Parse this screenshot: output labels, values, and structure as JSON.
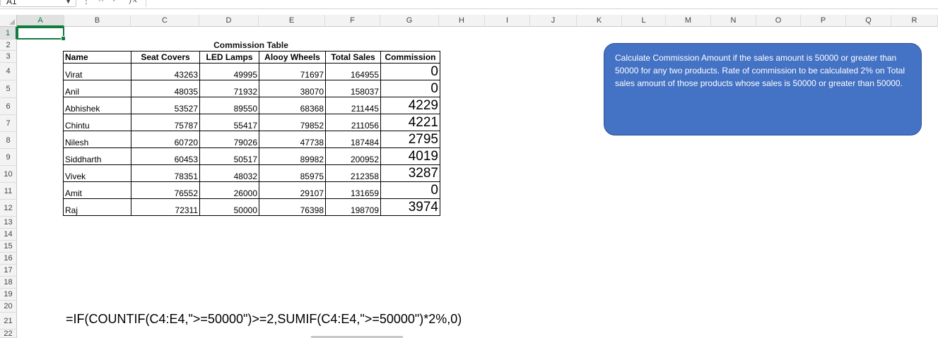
{
  "formula_bar": {
    "name_box": "A1",
    "fx_label": "fx",
    "formula": ""
  },
  "columns": [
    "A",
    "B",
    "C",
    "D",
    "E",
    "F",
    "G",
    "H",
    "I",
    "J",
    "K",
    "L",
    "M",
    "N",
    "O",
    "P",
    "Q",
    "R"
  ],
  "rows": [
    "1",
    "2",
    "3",
    "4",
    "5",
    "6",
    "7",
    "8",
    "9",
    "10",
    "11",
    "12",
    "13",
    "14",
    "15",
    "16",
    "17",
    "18",
    "19",
    "20",
    "21",
    "22"
  ],
  "commission_table": {
    "title": "Commission Table",
    "headers": [
      "Name",
      "Seat Covers",
      "LED Lamps",
      "Alooy Wheels",
      "Total Sales",
      "Commission"
    ],
    "rows": [
      {
        "name": "Virat",
        "seat_covers": "43263",
        "led_lamps": "49995",
        "alooy_wheels": "71697",
        "total_sales": "164955",
        "commission": "0"
      },
      {
        "name": "Anil",
        "seat_covers": "48035",
        "led_lamps": "71932",
        "alooy_wheels": "38070",
        "total_sales": "158037",
        "commission": "0"
      },
      {
        "name": "Abhishek",
        "seat_covers": "53527",
        "led_lamps": "89550",
        "alooy_wheels": "68368",
        "total_sales": "211445",
        "commission": "4229"
      },
      {
        "name": "Chintu",
        "seat_covers": "75787",
        "led_lamps": "55417",
        "alooy_wheels": "79852",
        "total_sales": "211056",
        "commission": "4221"
      },
      {
        "name": "Nilesh",
        "seat_covers": "60720",
        "led_lamps": "79026",
        "alooy_wheels": "47738",
        "total_sales": "187484",
        "commission": "2795"
      },
      {
        "name": "Siddharth",
        "seat_covers": "60453",
        "led_lamps": "50517",
        "alooy_wheels": "89982",
        "total_sales": "200952",
        "commission": "4019"
      },
      {
        "name": "Vivek",
        "seat_covers": "78351",
        "led_lamps": "48032",
        "alooy_wheels": "85975",
        "total_sales": "212358",
        "commission": "3287"
      },
      {
        "name": "Amit",
        "seat_covers": "76552",
        "led_lamps": "26000",
        "alooy_wheels": "29107",
        "total_sales": "131659",
        "commission": "0"
      },
      {
        "name": "Raj",
        "seat_covers": "72311",
        "led_lamps": "50000",
        "alooy_wheels": "76398",
        "total_sales": "198709",
        "commission": "3974"
      }
    ]
  },
  "note_text": "Calculate Commission Amount if the sales amount is  50000 or greater than 50000 for any two  products. Rate of commission to be calculated  2% on Total sales  amount of those  products whose sales is 50000 or greater than 50000.",
  "formula_text": "=IF(COUNTIF(C4:E4,\">=50000\")>=2,SUMIF(C4:E4,\">=50000\")*2%,0)",
  "colors": {
    "note_fill": "#4472c4",
    "selection_green": "#107c41"
  }
}
